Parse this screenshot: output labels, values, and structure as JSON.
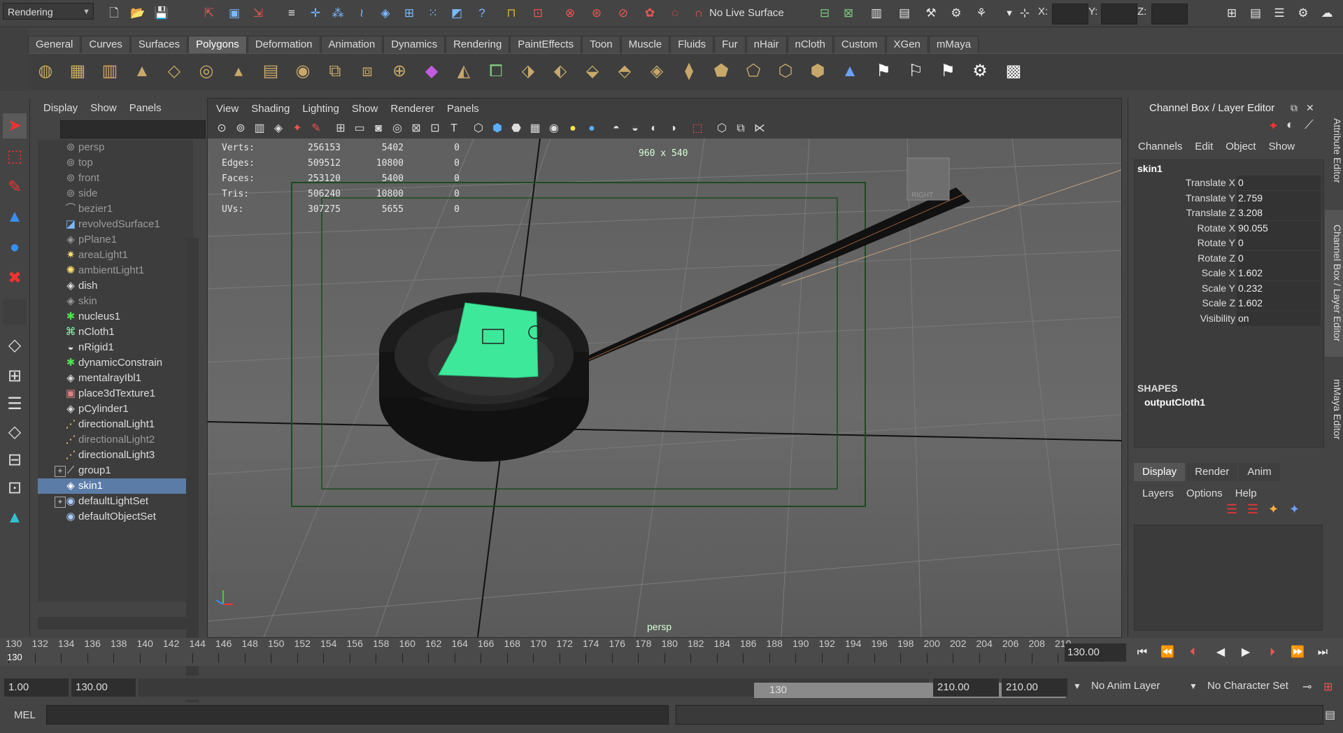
{
  "status_line": {
    "mode": "Rendering",
    "live_surface": "No Live Surface",
    "x_label": "X:",
    "y_label": "Y:",
    "z_label": "Z:"
  },
  "shelf_tabs": [
    "General",
    "Curves",
    "Surfaces",
    "Polygons",
    "Deformation",
    "Animation",
    "Dynamics",
    "Rendering",
    "PaintEffects",
    "Toon",
    "Muscle",
    "Fluids",
    "Fur",
    "nHair",
    "nCloth",
    "Custom",
    "XGen",
    "mMaya"
  ],
  "active_shelf_tab": "Polygons",
  "outliner": {
    "menu": [
      "Display",
      "Show",
      "Panels"
    ],
    "items": [
      {
        "label": "persp",
        "dim": true,
        "icon": "camera-icon",
        "expand": false
      },
      {
        "label": "top",
        "dim": true,
        "icon": "camera-icon",
        "expand": false
      },
      {
        "label": "front",
        "dim": true,
        "icon": "camera-icon",
        "expand": false
      },
      {
        "label": "side",
        "dim": true,
        "icon": "camera-icon",
        "expand": false
      },
      {
        "label": "bezier1",
        "dim": true,
        "icon": "curve-icon",
        "expand": false
      },
      {
        "label": "revolvedSurface1",
        "dim": true,
        "icon": "surface-icon",
        "expand": false
      },
      {
        "label": "pPlane1",
        "dim": true,
        "icon": "mesh-icon",
        "expand": false
      },
      {
        "label": "areaLight1",
        "dim": true,
        "icon": "area-light-icon",
        "expand": false
      },
      {
        "label": "ambientLight1",
        "dim": true,
        "icon": "ambient-light-icon",
        "expand": false
      },
      {
        "label": "dish",
        "dim": false,
        "icon": "mesh-icon",
        "expand": false
      },
      {
        "label": "skin",
        "dim": true,
        "icon": "mesh-icon",
        "expand": false
      },
      {
        "label": "nucleus1",
        "dim": false,
        "icon": "nucleus-icon",
        "expand": false
      },
      {
        "label": "nCloth1",
        "dim": false,
        "icon": "ncloth-icon",
        "expand": false
      },
      {
        "label": "nRigid1",
        "dim": false,
        "icon": "nrigid-icon",
        "expand": false
      },
      {
        "label": "dynamicConstrain",
        "dim": false,
        "icon": "constraint-icon",
        "expand": false
      },
      {
        "label": "mentalrayIbl1",
        "dim": false,
        "icon": "mesh-icon",
        "expand": false
      },
      {
        "label": "place3dTexture1",
        "dim": false,
        "icon": "texture-icon",
        "expand": false
      },
      {
        "label": "pCylinder1",
        "dim": false,
        "icon": "mesh-icon",
        "expand": false
      },
      {
        "label": "directionalLight1",
        "dim": false,
        "icon": "directional-light-icon",
        "expand": false
      },
      {
        "label": "directionalLight2",
        "dim": true,
        "icon": "directional-light-icon",
        "expand": false
      },
      {
        "label": "directionalLight3",
        "dim": false,
        "icon": "directional-light-icon",
        "expand": false
      },
      {
        "label": "group1",
        "dim": false,
        "icon": "group-icon",
        "expand": true
      },
      {
        "label": "skin1",
        "dim": false,
        "icon": "mesh-icon",
        "expand": false,
        "selected": true
      },
      {
        "label": "defaultLightSet",
        "dim": false,
        "icon": "set-icon",
        "expand": true
      },
      {
        "label": "defaultObjectSet",
        "dim": false,
        "icon": "set-icon",
        "expand": false
      }
    ]
  },
  "viewport": {
    "menu": [
      "View",
      "Shading",
      "Lighting",
      "Show",
      "Renderer",
      "Panels"
    ],
    "hud": [
      {
        "label": "Verts:",
        "v1": "256153",
        "v2": "5402",
        "v3": "0"
      },
      {
        "label": "Edges:",
        "v1": "509512",
        "v2": "10800",
        "v3": "0"
      },
      {
        "label": "Faces:",
        "v1": "253120",
        "v2": "5400",
        "v3": "0"
      },
      {
        "label": "Tris:",
        "v1": "506240",
        "v2": "10800",
        "v3": "0"
      },
      {
        "label": "UVs:",
        "v1": "307275",
        "v2": "5655",
        "v3": "0"
      }
    ],
    "resolution": "960 x 540",
    "camera": "persp",
    "cube_label": "RIGHT"
  },
  "channel_box": {
    "title": "Channel Box / Layer Editor",
    "menu": [
      "Channels",
      "Edit",
      "Object",
      "Show"
    ],
    "object": "skin1",
    "channels": [
      {
        "name": "Translate X",
        "value": "0"
      },
      {
        "name": "Translate Y",
        "value": "2.759"
      },
      {
        "name": "Translate Z",
        "value": "3.208"
      },
      {
        "name": "Rotate X",
        "value": "90.055"
      },
      {
        "name": "Rotate Y",
        "value": "0"
      },
      {
        "name": "Rotate Z",
        "value": "0"
      },
      {
        "name": "Scale X",
        "value": "1.602"
      },
      {
        "name": "Scale Y",
        "value": "0.232"
      },
      {
        "name": "Scale Z",
        "value": "1.602"
      },
      {
        "name": "Visibility",
        "value": "on"
      }
    ],
    "shapes_label": "SHAPES",
    "shape": "outputCloth1",
    "layer_tabs": [
      "Display",
      "Render",
      "Anim"
    ],
    "layer_menu": [
      "Layers",
      "Options",
      "Help"
    ]
  },
  "side_tabs": [
    "Attribute Editor",
    "Channel Box / Layer Editor",
    "mMaya Editor"
  ],
  "timeline": {
    "ticks": [
      "130",
      "132",
      "134",
      "136",
      "138",
      "140",
      "142",
      "144",
      "146",
      "148",
      "150",
      "152",
      "154",
      "156",
      "158",
      "160",
      "162",
      "164",
      "166",
      "168",
      "170",
      "172",
      "174",
      "176",
      "178",
      "180",
      "182",
      "184",
      "186",
      "188",
      "190",
      "192",
      "194",
      "196",
      "198",
      "200",
      "202",
      "204",
      "206",
      "208",
      "210"
    ],
    "current_marker": "130",
    "current_time": "130.00"
  },
  "range": {
    "start": "1.00",
    "playback_start": "130.00",
    "thumb_start": "130",
    "thumb_end": "210",
    "playback_end": "210.00",
    "end": "210.00",
    "anim_layer": "No Anim Layer",
    "character_set": "No Character Set"
  },
  "command_line": {
    "label": "MEL"
  },
  "colors": {
    "selection": "#5b7ca6",
    "cloth": "#3ee89a",
    "resolution_gate": "#1d4a22"
  }
}
